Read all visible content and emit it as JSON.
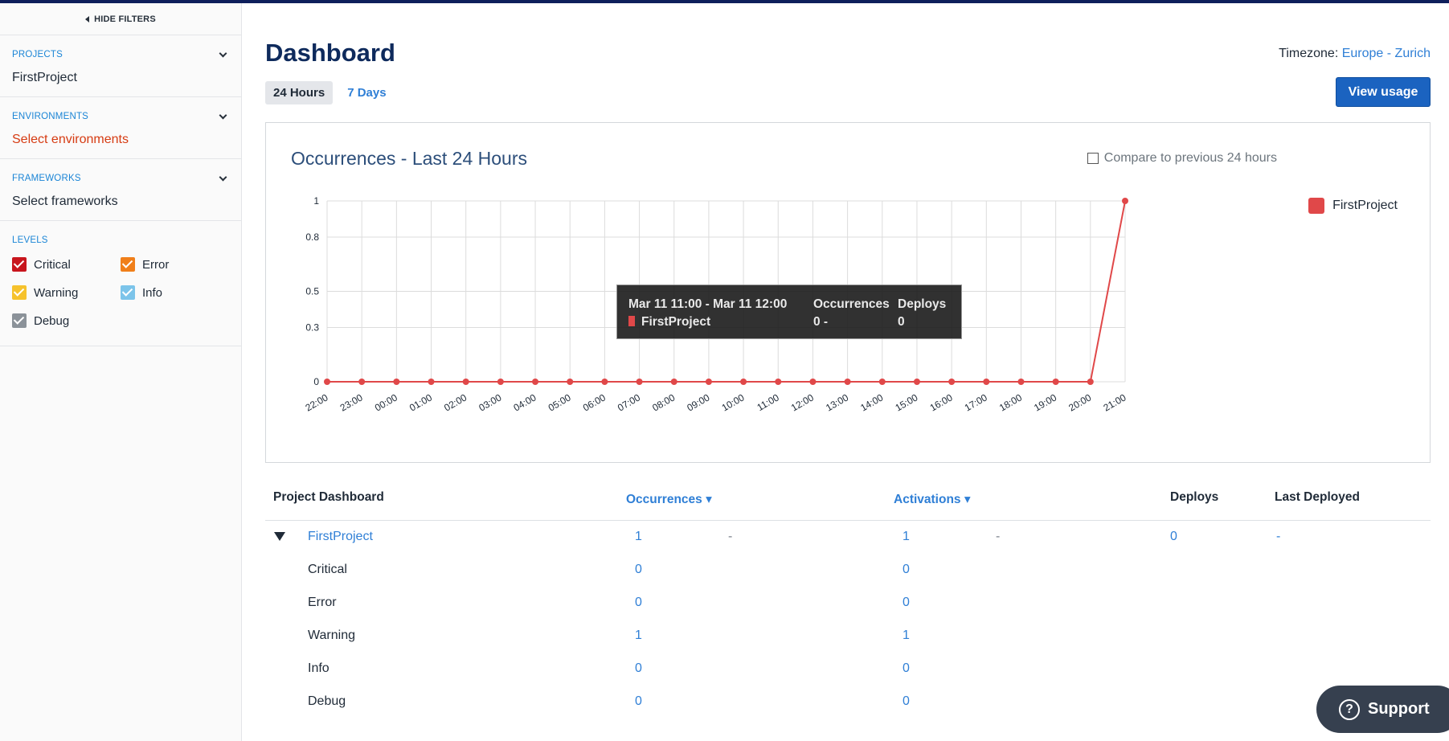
{
  "sidebar": {
    "hide_filters": "HIDE FILTERS",
    "projects": {
      "title": "PROJECTS",
      "value": "FirstProject"
    },
    "environments": {
      "title": "ENVIRONMENTS",
      "value": "Select environments"
    },
    "frameworks": {
      "title": "FRAMEWORKS",
      "value": "Select frameworks"
    },
    "levels": {
      "title": "LEVELS",
      "items": [
        {
          "label": "Critical",
          "color": "#c8151d",
          "checked": true
        },
        {
          "label": "Error",
          "color": "#f07f1a",
          "checked": true
        },
        {
          "label": "Warning",
          "color": "#f6c22c",
          "checked": true
        },
        {
          "label": "Info",
          "color": "#7cc4ea",
          "checked": true
        },
        {
          "label": "Debug",
          "color": "#8b9299",
          "checked": true
        }
      ]
    }
  },
  "header": {
    "title": "Dashboard",
    "timezone_label": "Timezone:",
    "timezone_value": "Europe - Zurich",
    "tabs": [
      "24 Hours",
      "7 Days"
    ],
    "view_usage": "View usage"
  },
  "chart": {
    "title": "Occurrences - Last 24 Hours",
    "compare_label": "Compare to previous 24 hours",
    "tooltip": {
      "range": "Mar 11 11:00 - Mar 11 12:00",
      "col_occ": "Occurrences",
      "col_dep": "Deploys",
      "series": "FirstProject",
      "occ_value": "0 -",
      "dep_value": "0"
    }
  },
  "chart_data": {
    "type": "line",
    "title": "Occurrences - Last 24 Hours",
    "x": [
      "22:00",
      "23:00",
      "00:00",
      "01:00",
      "02:00",
      "03:00",
      "04:00",
      "05:00",
      "06:00",
      "07:00",
      "08:00",
      "09:00",
      "10:00",
      "11:00",
      "12:00",
      "13:00",
      "14:00",
      "15:00",
      "16:00",
      "17:00",
      "18:00",
      "19:00",
      "20:00",
      "21:00"
    ],
    "y_ticks": [
      "0",
      "0.3",
      "0.5",
      "0.8",
      "1"
    ],
    "ylim": [
      0,
      1
    ],
    "grid": true,
    "legend": "right",
    "series": [
      {
        "name": "FirstProject",
        "color": "#e04849",
        "values": [
          0,
          0,
          0,
          0,
          0,
          0,
          0,
          0,
          0,
          0,
          0,
          0,
          0,
          0,
          0,
          0,
          0,
          0,
          0,
          0,
          0,
          0,
          0,
          1
        ]
      }
    ]
  },
  "table": {
    "headers": {
      "project": "Project Dashboard",
      "occurrences": "Occurrences ▾",
      "activations": "Activations ▾",
      "deploys": "Deploys",
      "last_deployed": "Last Deployed"
    },
    "project": {
      "name": "FirstProject",
      "occurrences": "1",
      "occ_change": "-",
      "activations": "1",
      "act_change": "-",
      "deploys": "0",
      "last_deployed": "-"
    },
    "levels": [
      {
        "label": "Critical",
        "occurrences": "0",
        "activations": "0"
      },
      {
        "label": "Error",
        "occurrences": "0",
        "activations": "0"
      },
      {
        "label": "Warning",
        "occurrences": "1",
        "activations": "1"
      },
      {
        "label": "Info",
        "occurrences": "0",
        "activations": "0"
      },
      {
        "label": "Debug",
        "occurrences": "0",
        "activations": "0"
      }
    ]
  },
  "support": {
    "label": "Support",
    "icon": "question-circle-icon"
  }
}
